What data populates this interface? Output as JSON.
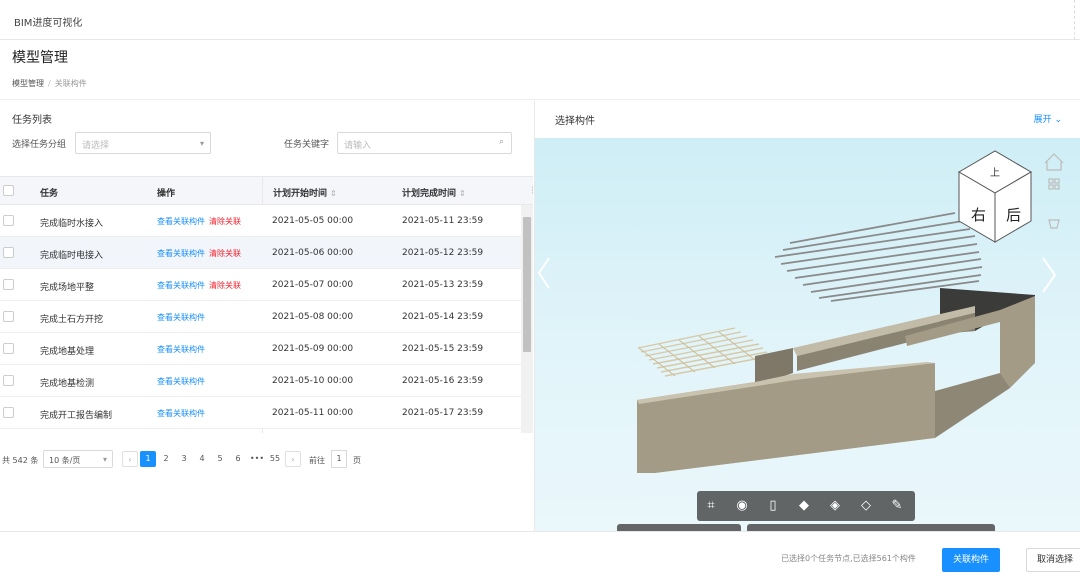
{
  "app_title": "BIM进度可视化",
  "page_title": "模型管理",
  "breadcrumb": [
    "模型管理",
    "关联构件"
  ],
  "left": {
    "section_title": "任务列表",
    "group_label": "选择任务分组",
    "group_placeholder": "请选择",
    "keyword_label": "任务关键字",
    "keyword_placeholder": "请输入",
    "columns": [
      "任务",
      "操作",
      "计划开始时间",
      "计划完成时间"
    ],
    "view_link": "查看关联构件",
    "remove_link": "清除关联",
    "rows": [
      {
        "task": "完成临时水接入",
        "start": "2021-05-05 00:00",
        "end": "2021-05-11 23:59",
        "has_remove": true
      },
      {
        "task": "完成临时电接入",
        "start": "2021-05-06 00:00",
        "end": "2021-05-12 23:59",
        "has_remove": true
      },
      {
        "task": "完成场地平整",
        "start": "2021-05-07 00:00",
        "end": "2021-05-13 23:59",
        "has_remove": true
      },
      {
        "task": "完成土石方开挖",
        "start": "2021-05-08 00:00",
        "end": "2021-05-14 23:59",
        "has_remove": false
      },
      {
        "task": "完成地基处理",
        "start": "2021-05-09 00:00",
        "end": "2021-05-15 23:59",
        "has_remove": false
      },
      {
        "task": "完成地基检测",
        "start": "2021-05-10 00:00",
        "end": "2021-05-16 23:59",
        "has_remove": false
      },
      {
        "task": "完成开工报告编制",
        "start": "2021-05-11 00:00",
        "end": "2021-05-17 23:59",
        "has_remove": false
      }
    ],
    "pager": {
      "total": "共 542 条",
      "page_size": "10 条/页",
      "pages": [
        "1",
        "2",
        "3",
        "4",
        "5",
        "6",
        "•••",
        "55"
      ],
      "active_page": "1",
      "goto_label": "前往",
      "goto_value": "1",
      "page_unit": "页"
    }
  },
  "right": {
    "title": "选择构件",
    "expand": "展开",
    "cube_faces": [
      "上",
      "右",
      "后"
    ]
  },
  "footer": {
    "info": "已选择0个任务节点,已选择561个构件",
    "primary": "关联构件",
    "secondary": "取消选择"
  },
  "colors": {
    "accent": "#1890ff",
    "danger": "#f5222d",
    "wall": "#a39b86"
  }
}
